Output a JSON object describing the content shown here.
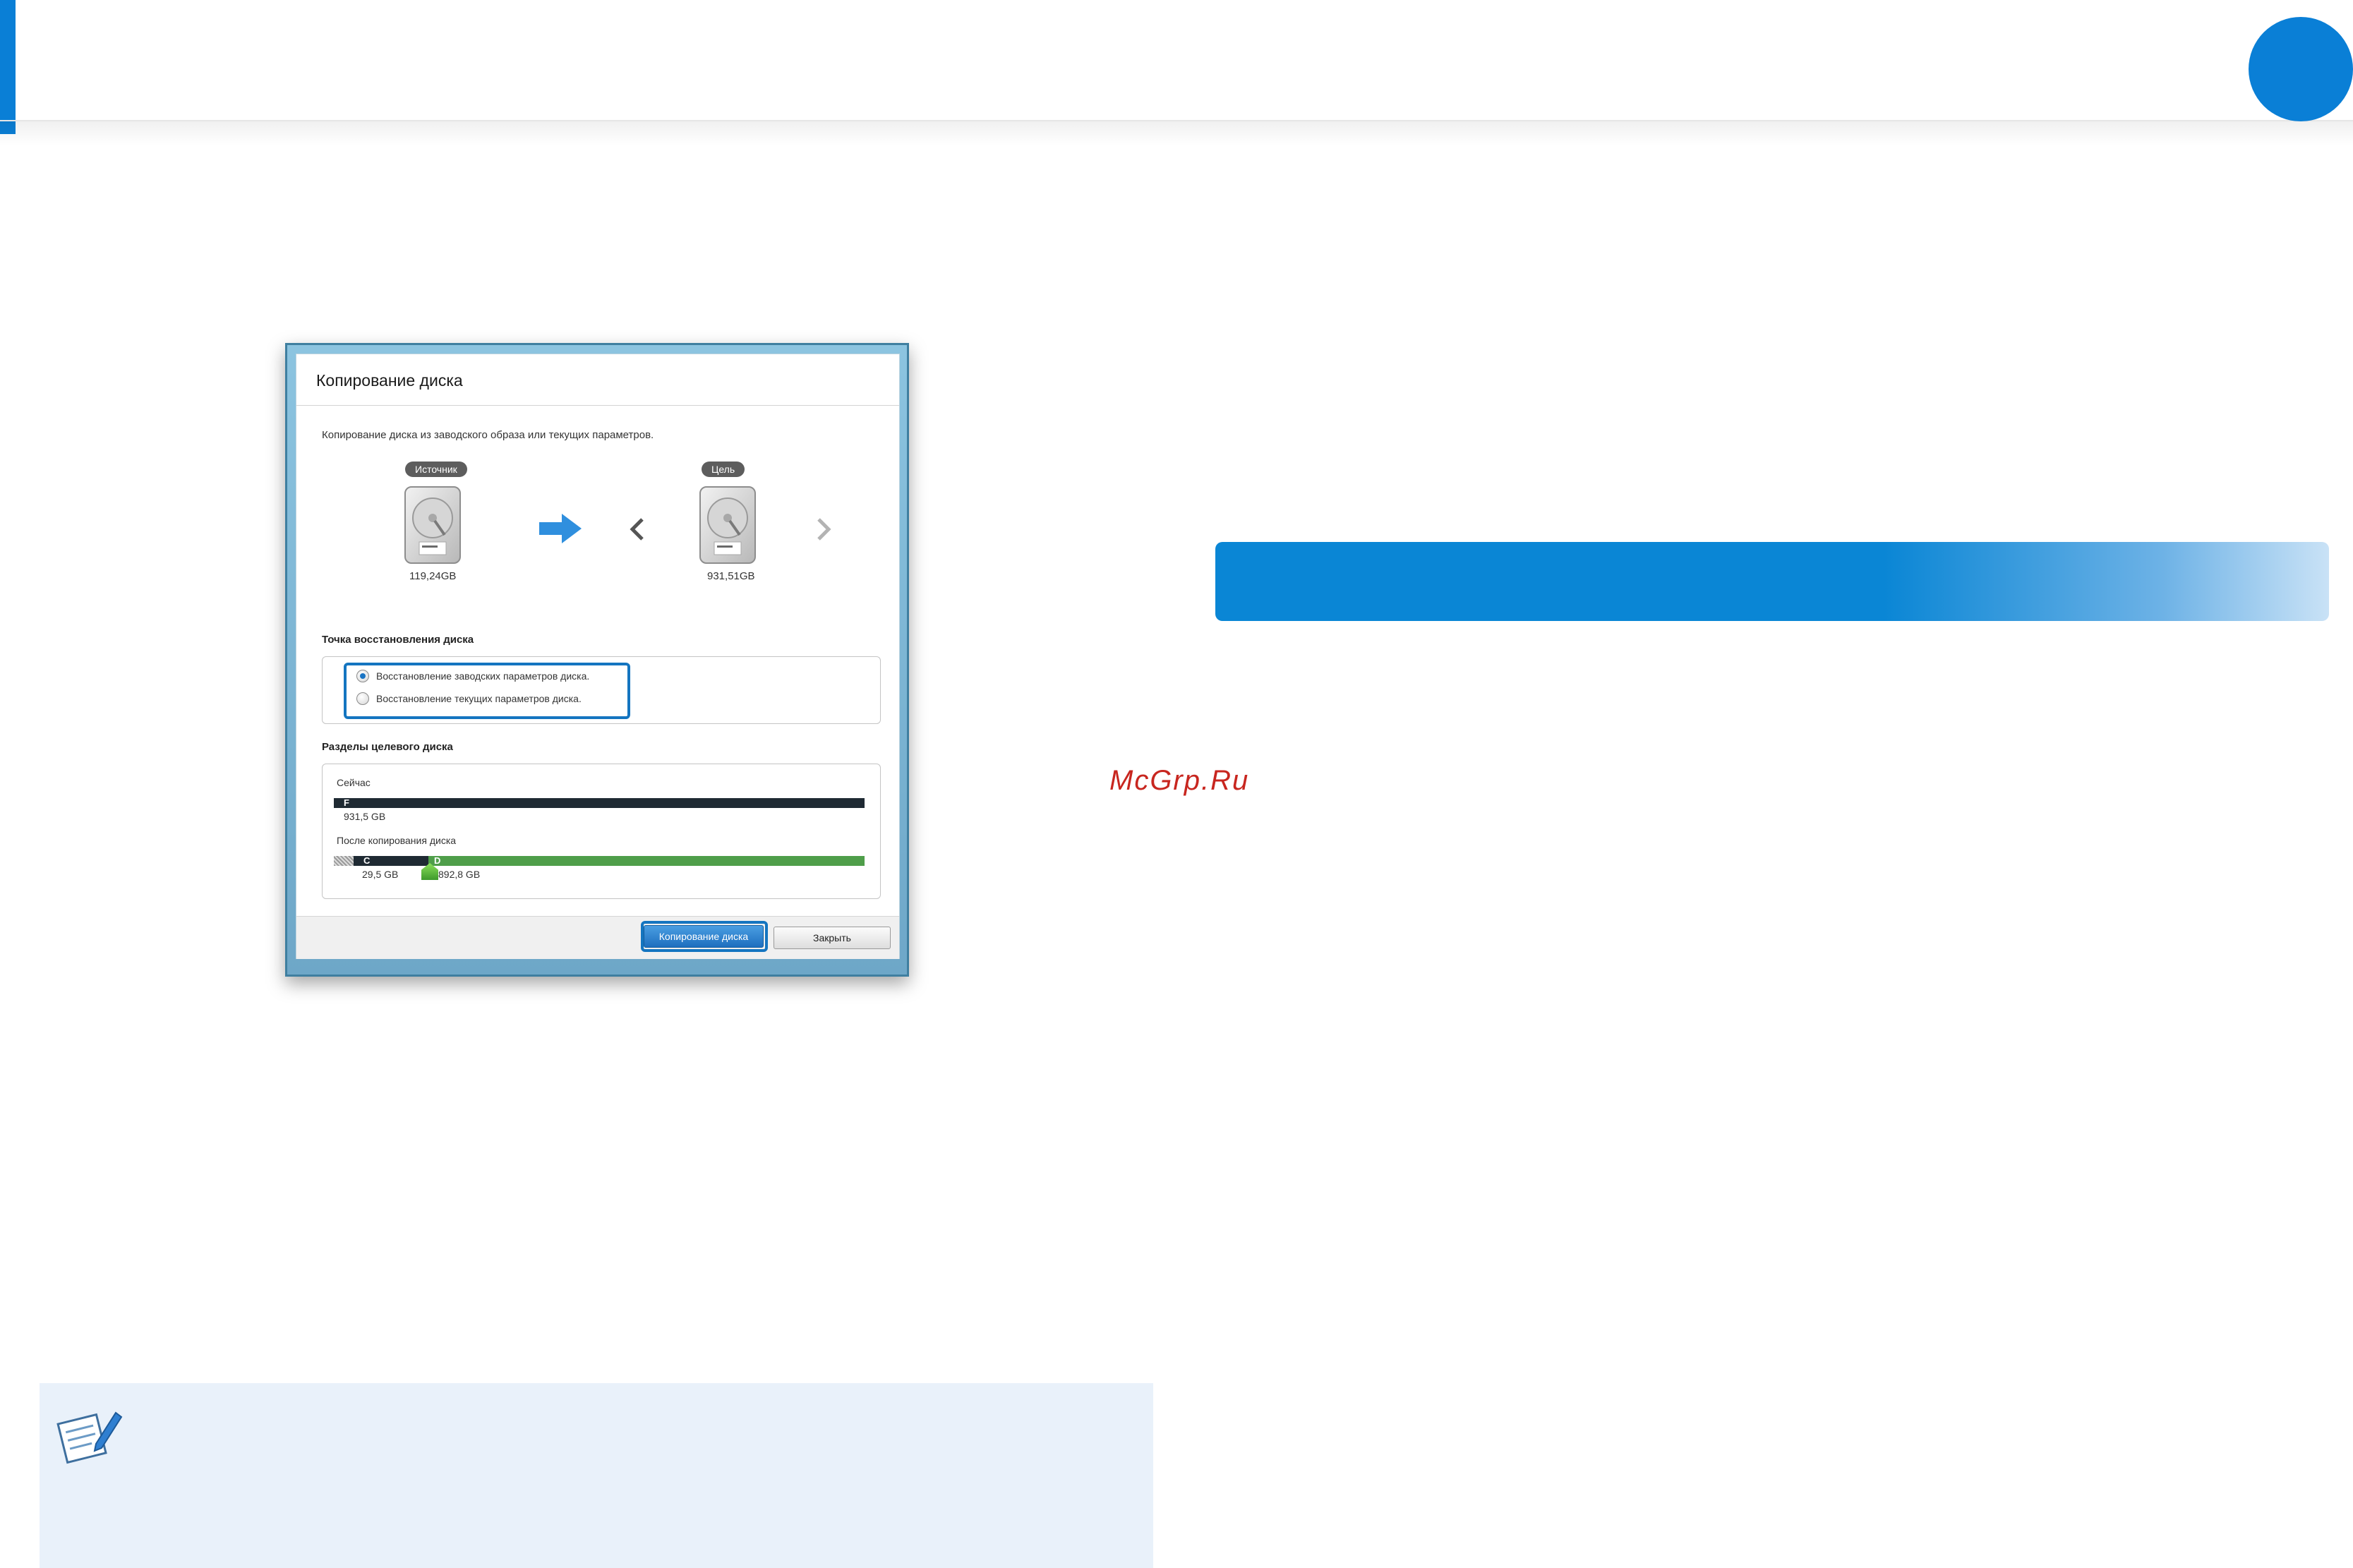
{
  "watermark": "McGrp.Ru",
  "dialog": {
    "title": "Копирование диска",
    "description": "Копирование диска из заводского образа или текущих параметров.",
    "source": {
      "label": "Источник",
      "size": "119,24GB"
    },
    "target": {
      "label": "Цель",
      "size": "931,51GB"
    },
    "restore_section": {
      "heading": "Точка восстановления диска",
      "options": [
        {
          "label": "Восстановление заводских параметров диска.",
          "selected": true
        },
        {
          "label": "Восстановление текущих параметров диска.",
          "selected": false
        }
      ]
    },
    "partitions_section": {
      "heading": "Разделы целевого диска",
      "now_label": "Сейчас",
      "now_partition": {
        "letter": "F",
        "size": "931,5 GB"
      },
      "after_label": "После копирования диска",
      "after_partitions": [
        {
          "letter": "C",
          "size": "29,5 GB"
        },
        {
          "letter": "D",
          "size": "892,8 GB"
        }
      ]
    },
    "buttons": {
      "copy": "Копирование диска",
      "close": "Закрыть"
    }
  },
  "colors": {
    "accent_blue": "#0a7fd6",
    "highlight_border": "#1475c0",
    "partition_dark": "#1f2a33",
    "partition_green": "#4f9e4a",
    "note_background": "#e9f1fa",
    "watermark": "#c8261f"
  },
  "icons": [
    "hard-drive-icon",
    "arrow-right-icon",
    "chevron-left-icon",
    "chevron-right-icon",
    "note-pencil-icon"
  ]
}
